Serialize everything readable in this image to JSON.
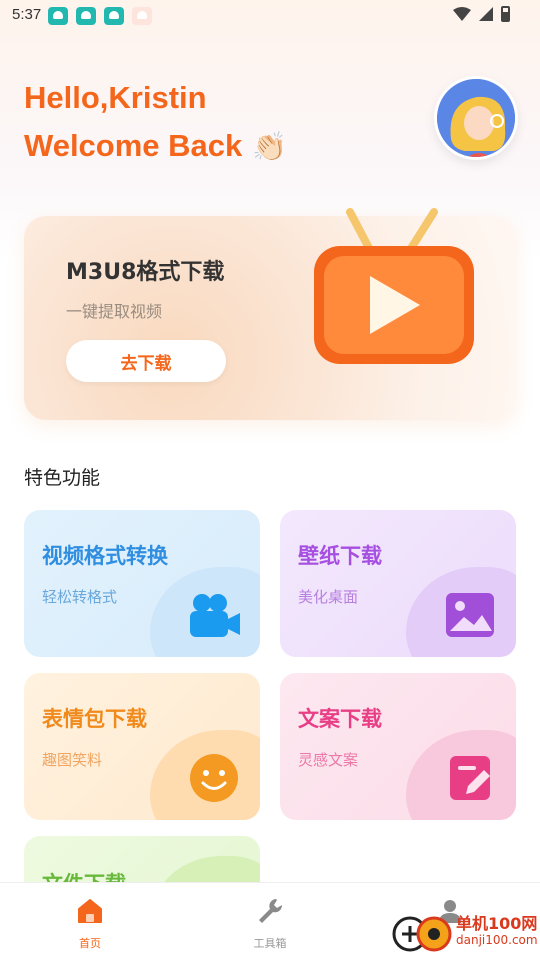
{
  "status_bar": {
    "time": "5:37"
  },
  "greeting": {
    "line1": "Hello,Kristin",
    "line2": "Welcome Back",
    "emoji": "👏🏻"
  },
  "banner": {
    "title": "M3U8格式下载",
    "subtitle": "一键提取视频",
    "button_label": "去下载",
    "icon": "tv-play-icon"
  },
  "section_title": "特色功能",
  "features": [
    {
      "title": "视频格式转换",
      "subtitle": "轻松转格式",
      "icon": "video-camera-icon",
      "color": "#2f8ee0"
    },
    {
      "title": "壁纸下载",
      "subtitle": "美化桌面",
      "icon": "image-icon",
      "color": "#a64fe0"
    },
    {
      "title": "表情包下载",
      "subtitle": "趣图笑料",
      "icon": "smiley-icon",
      "color": "#f08a1c"
    },
    {
      "title": "文案下载",
      "subtitle": "灵感文案",
      "icon": "edit-note-icon",
      "color": "#e83e86"
    },
    {
      "title": "文件下载",
      "subtitle": "",
      "icon": "",
      "color": "#68b93b"
    }
  ],
  "bottom_nav": [
    {
      "label": "首页",
      "icon": "home-icon",
      "active": true
    },
    {
      "label": "工具箱",
      "icon": "wrench-icon",
      "active": false
    },
    {
      "label": "",
      "icon": "user-icon",
      "active": false
    }
  ],
  "watermark": {
    "title": "单机100网",
    "url": "danji100.com"
  },
  "colors": {
    "accent": "#f4661b"
  }
}
